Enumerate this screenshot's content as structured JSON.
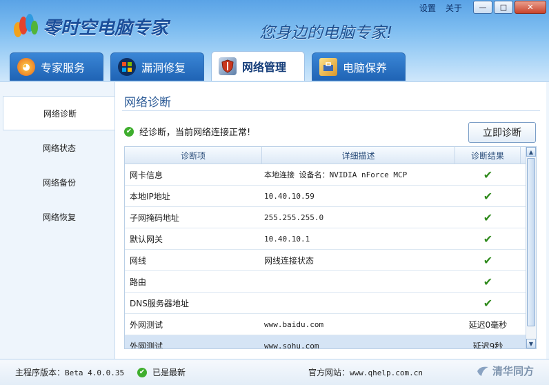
{
  "app": {
    "name": "零时空电脑专家",
    "slogan": "您身边的电脑专家!",
    "top_links": [
      "设置",
      "关于"
    ],
    "window_buttons": {
      "minimize": "—",
      "restore": "□",
      "close": "✕"
    }
  },
  "tabs": [
    {
      "label": "专家服务",
      "icon": "expert-icon",
      "active": false
    },
    {
      "label": "漏洞修复",
      "icon": "windows-icon",
      "active": false
    },
    {
      "label": "网络管理",
      "icon": "shield-icon",
      "active": true
    },
    {
      "label": "电脑保养",
      "icon": "toolbox-icon",
      "active": false
    }
  ],
  "sidebar": {
    "items": [
      {
        "label": "网络诊断",
        "active": true
      },
      {
        "label": "网络状态",
        "active": false
      },
      {
        "label": "网络备份",
        "active": false
      },
      {
        "label": "网络恢复",
        "active": false
      }
    ]
  },
  "main": {
    "title": "网络诊断",
    "status_text": "经诊断，当前网络连接正常!",
    "diagnose_button": "立即诊断",
    "columns": [
      "诊断项",
      "详细描述",
      "诊断结果"
    ],
    "rows": [
      {
        "item": "网卡信息",
        "detail": "本地连接  设备名：NVIDIA nForce MCP",
        "result": "✔"
      },
      {
        "item": "本地IP地址",
        "detail": "10.40.10.59",
        "result": "✔"
      },
      {
        "item": "子网掩码地址",
        "detail": "255.255.255.0",
        "result": "✔"
      },
      {
        "item": "默认网关",
        "detail": "10.40.10.1",
        "result": "✔"
      },
      {
        "item": "网线",
        "detail": "网线连接状态",
        "result": "✔"
      },
      {
        "item": "路由",
        "detail": "",
        "result": "✔"
      },
      {
        "item": "DNS服务器地址",
        "detail": "",
        "result": "✔"
      },
      {
        "item": "外网测试",
        "detail": "www.baidu.com",
        "result": "延迟0毫秒"
      },
      {
        "item": "外网测试",
        "detail": "www.sohu.com",
        "result": "延迟9秒"
      }
    ]
  },
  "footer": {
    "version_label": "主程序版本：",
    "version": "Beta 4.0.0.35",
    "latest_text": "已是最新",
    "site_label": "官方网站：",
    "site_url": "www.qhelp.com.cn",
    "brand": "清华同方"
  },
  "colors": {
    "header_top": "#5aa3e6",
    "tab_blue": "#1f63b4",
    "ok_green": "#3fae2e",
    "title_blue": "#2b5a96"
  }
}
